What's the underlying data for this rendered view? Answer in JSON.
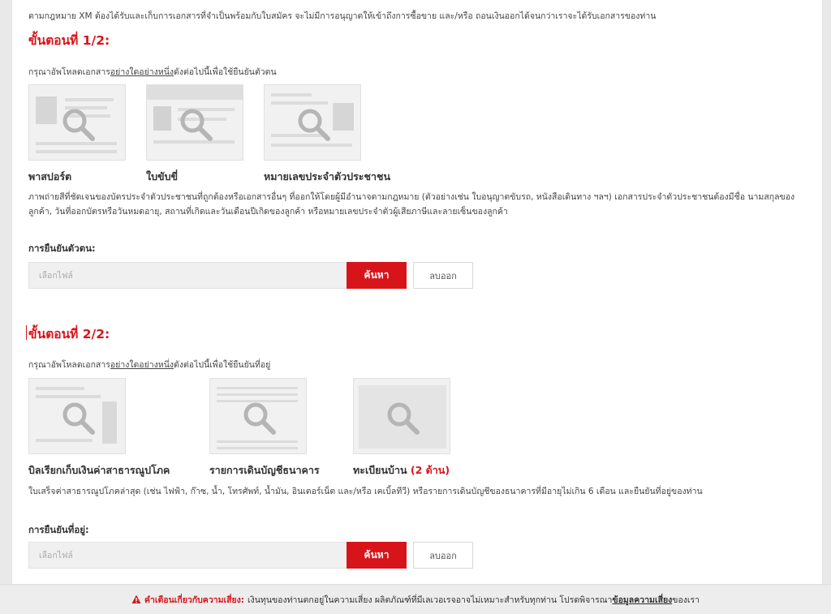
{
  "intro": "ตามกฎหมาย XM ต้องได้รับและเก็บการเอกสารที่จำเป็นพร้อมกับใบสมัคร จะไม่มีการอนุญาตให้เข้าถึงการซื้อขาย และ/หรือ ถอนเงินออกได้จนกว่าเราจะได้รับเอกสารของท่าน",
  "step1": {
    "title": "ขั้นตอนที่ 1/2:",
    "instruction_pre": "กรุณาอัพโหลดเอกสาร",
    "instruction_u": "อย่างใดอย่างหนึ่ง",
    "instruction_post": "ดังต่อไปนี้เพื่อใช้ยืนยันตัวตน",
    "docs": [
      "พาสปอร์ต",
      "ใบขับขี่",
      "หมายเลขประจำตัวประชาชน"
    ],
    "description": "ภาพถ่ายสีที่ชัดเจนของบัตรประจำตัวประชาชนที่ถูกต้องหรือเอกสารอื่นๆ ที่ออกให้โดยผู้มีอำนาจตามกฎหมาย (ตัวอย่างเช่น ใบอนุญาตขับรถ, หนังสือเดินทาง ฯลฯ) เอกสารประจำตัวประชาชนต้องมีชื่อ นามสกุลของลูกค้า, วันที่ออกบัตรหรือวันหมดอายุ, สถานที่เกิดและวันเดือนปีเกิดของลูกค้า หรือหมายเลขประจำตัวผู้เสียภาษีและลายเซ็นของลูกค้า",
    "field_label": "การยืนยันตัวตน:",
    "file_placeholder": "เลือกไฟล์",
    "search_label": "ค้นหา",
    "remove_label": "ลบออก"
  },
  "step2": {
    "title": "ขั้นตอนที่ 2/2:",
    "instruction_pre": "กรุณาอัพโหลดเอกสาร",
    "instruction_u": "อย่างใดอย่างหนึ่ง",
    "instruction_post": "ดังต่อไปนี้เพื่อใช้ยืนยันที่อยู่",
    "docs": [
      "บิลเรียกเก็บเงินค่าสาธารณูปโภค",
      "รายการเดินบัญชีธนาคาร",
      "ทะเบียนบ้าน"
    ],
    "doc3_suffix": "(2 ด้าน)",
    "description": "ใบเสร็จค่าสาธารณูปโภคล่าสุด (เช่น ไฟฟ้า, ก๊าซ, น้ำ, โทรศัพท์, น้ำมัน, อินเตอร์เน็ต และ/หรือ เคเบิ้ลทีวี) หรือรายการเดินบัญชีของธนาคารที่มีอายุไม่เกิน 6 เดือน และยืนยันที่อยู่ของท่าน",
    "field_label": "การยืนยันที่อยู่:",
    "file_placeholder": "เลือกไฟล์",
    "search_label": "ค้นหา",
    "remove_label": "ลบออก"
  },
  "footer": {
    "warning_label": "คำเตือนเกี่ยวกับความเสี่ยง:",
    "text": "เงินทุนของท่านตกอยู่ในความเสี่ยง ผลิตภัณฑ์ที่มีเลเวอเรจอาจไม่เหมาะสำหรับทุกท่าน โปรดพิจารณา",
    "link": "ข้อมูลความเสี่ยง",
    "text_after": "ของเรา"
  },
  "colors": {
    "accent": "#d8141b"
  }
}
